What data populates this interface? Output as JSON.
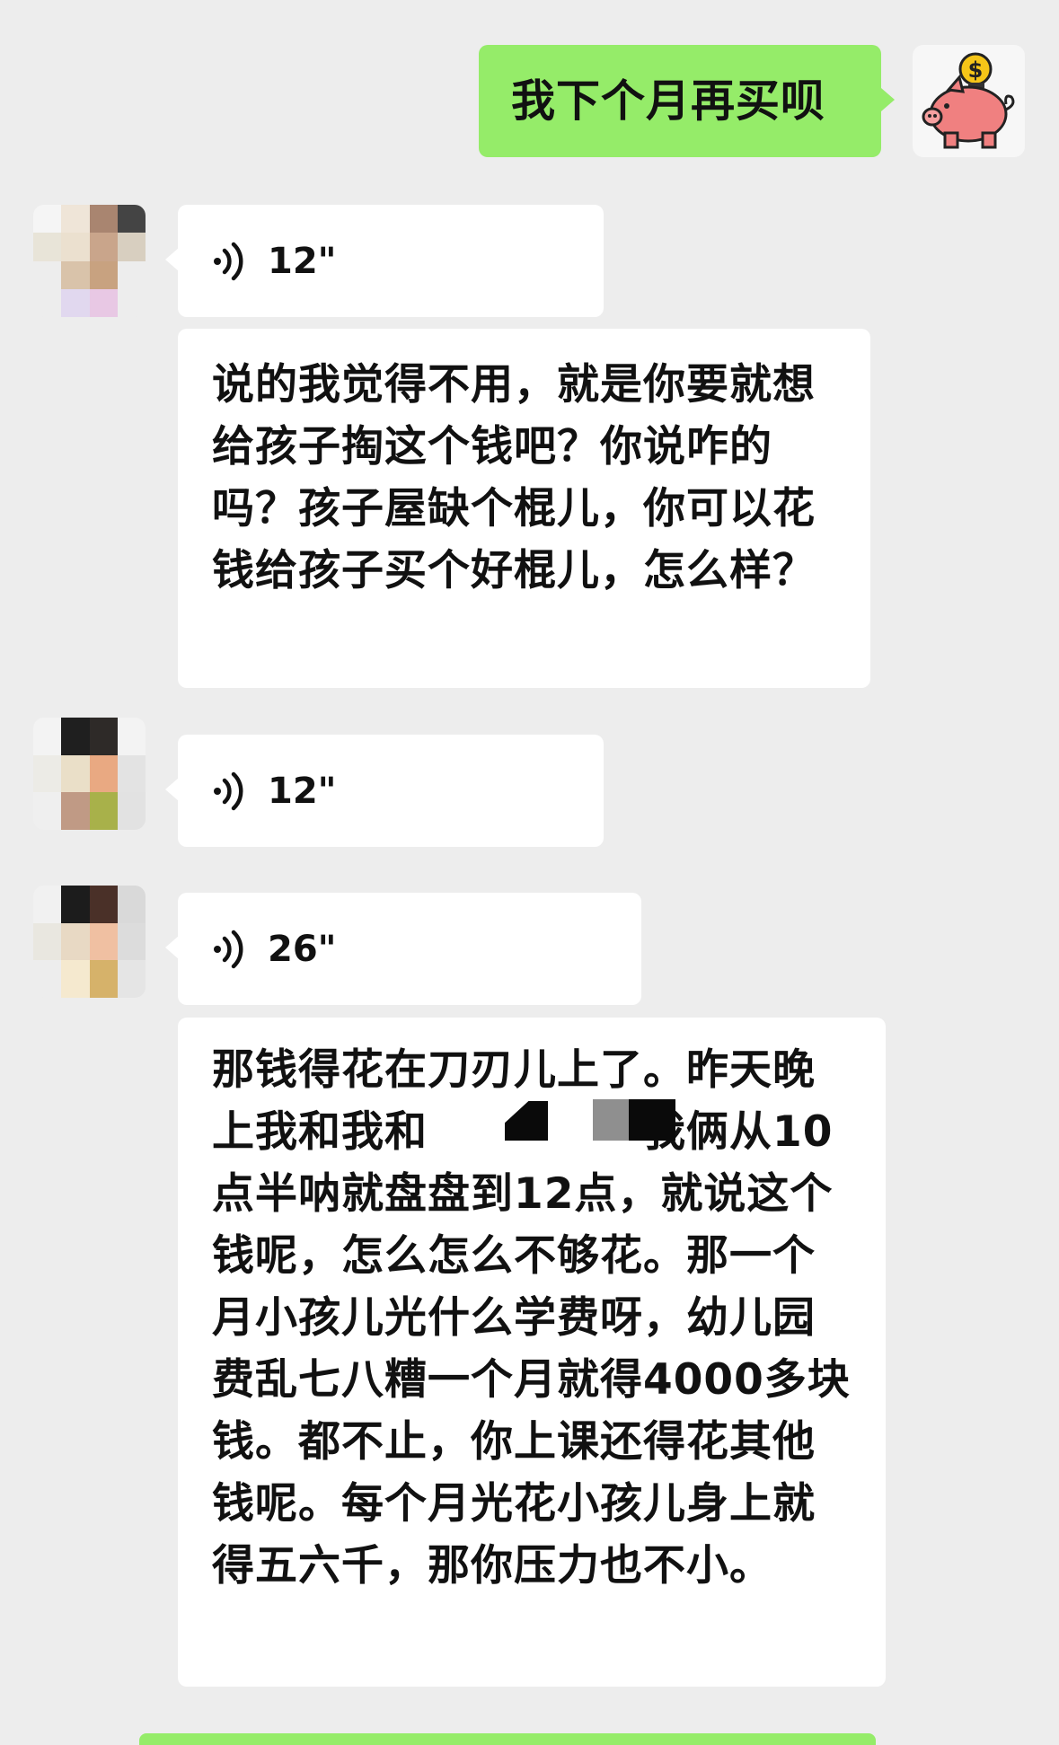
{
  "chat": {
    "messages": [
      {
        "side": "right",
        "type": "text",
        "text": "我下个月再买呗"
      },
      {
        "side": "left",
        "type": "voice",
        "duration": "12\""
      },
      {
        "side": "left",
        "type": "text",
        "text": "说的我觉得不用，就是你要就想给孩子掏这个钱吧？你说咋的吗？孩子屋缺个棍儿，你可以花钱给孩子买个好棍儿，怎么样？"
      },
      {
        "side": "left",
        "type": "voice",
        "duration": "12\""
      },
      {
        "side": "left",
        "type": "voice",
        "duration": "26\""
      },
      {
        "side": "left",
        "type": "text",
        "text": "那钱得花在刀刃儿上了。昨天晚上我和我和　　　　　我俩从10点半呐就盘盘到12点，就说这个钱呢，怎么怎么不够花。那一个月小孩儿光什么学费呀，幼儿园费乱七八糟一个月就得4000多块钱。都不止，你上课还得花其他钱呢。每个月光花小孩儿身上就得五六千，那你压力也不小。"
      }
    ]
  },
  "icons": {
    "self_avatar": "piggy-bank-icon",
    "voice": "voice-wave-icon"
  },
  "colors": {
    "background": "#ededed",
    "self_bubble": "#95ec69",
    "other_bubble": "#ffffff",
    "pig": "#f08080",
    "coin": "#f5c518"
  }
}
